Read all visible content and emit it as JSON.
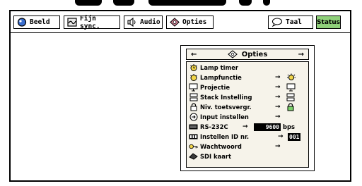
{
  "tabs": [
    {
      "label": "Beeld",
      "icon": "picture-icon"
    },
    {
      "label": "Fijn sync.",
      "icon": "fine-sync-icon"
    },
    {
      "label": "Audio",
      "icon": "speaker-icon"
    },
    {
      "label": "Opties",
      "icon": "options-icon"
    },
    {
      "label": "Taal",
      "icon": "speech-bubble-icon"
    },
    {
      "label": "Status",
      "icon": ""
    }
  ],
  "menu": {
    "title": "Opties",
    "items": [
      {
        "label": "Lamp timer",
        "icon": "lamp-icon",
        "has_arrow": false
      },
      {
        "label": "Lampfunctie",
        "icon": "lamp-icon",
        "has_arrow": true,
        "tail": "lamp-mode-icon"
      },
      {
        "label": "Projectie",
        "icon": "projection-icon",
        "has_arrow": true,
        "tail": "projection-icon"
      },
      {
        "label": "Stack Instelling",
        "icon": "stack-icon",
        "has_arrow": true,
        "tail": "stack-icon"
      },
      {
        "label": "Niv. toetsvergr.",
        "icon": "lock-icon",
        "has_arrow": true,
        "tail": "lock-icon"
      },
      {
        "label": "Input instellen",
        "icon": "input-icon",
        "has_arrow": true
      },
      {
        "label": "RS-232C",
        "icon": "rs232c-icon",
        "has_arrow": true,
        "value": "9600",
        "unit": "bps"
      },
      {
        "label": "Instellen ID nr.",
        "icon": "id-icon",
        "has_arrow": true,
        "value": "001"
      },
      {
        "label": "Wachtwoord",
        "icon": "key-icon",
        "has_arrow": true
      },
      {
        "label": "SDI kaart",
        "icon": "sdi-card-icon",
        "has_arrow": false
      }
    ]
  },
  "colors": {
    "status_tab": "#8fd07a",
    "menu_bg": "#f6f3ea"
  }
}
